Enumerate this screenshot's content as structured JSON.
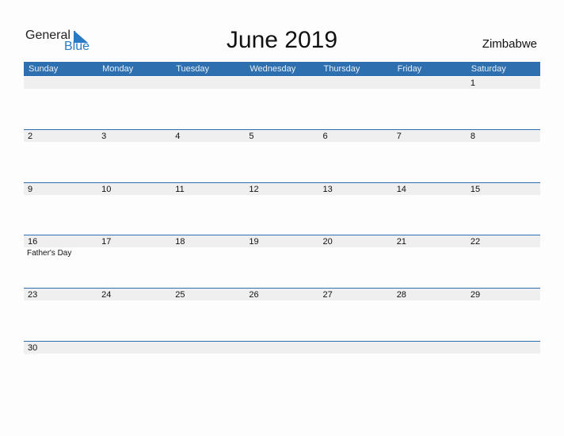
{
  "logo": {
    "line1": "General",
    "line2": "Blue"
  },
  "title": "June 2019",
  "country": "Zimbabwe",
  "colors": {
    "accent": "#2e6fb0",
    "strip": "#efefef"
  },
  "weekdays": [
    "Sunday",
    "Monday",
    "Tuesday",
    "Wednesday",
    "Thursday",
    "Friday",
    "Saturday"
  ],
  "weeks": [
    {
      "days": [
        "",
        "",
        "",
        "",
        "",
        "",
        "1"
      ],
      "events": [
        "",
        "",
        "",
        "",
        "",
        "",
        ""
      ]
    },
    {
      "days": [
        "2",
        "3",
        "4",
        "5",
        "6",
        "7",
        "8"
      ],
      "events": [
        "",
        "",
        "",
        "",
        "",
        "",
        ""
      ]
    },
    {
      "days": [
        "9",
        "10",
        "11",
        "12",
        "13",
        "14",
        "15"
      ],
      "events": [
        "",
        "",
        "",
        "",
        "",
        "",
        ""
      ]
    },
    {
      "days": [
        "16",
        "17",
        "18",
        "19",
        "20",
        "21",
        "22"
      ],
      "events": [
        "Father's Day",
        "",
        "",
        "",
        "",
        "",
        ""
      ]
    },
    {
      "days": [
        "23",
        "24",
        "25",
        "26",
        "27",
        "28",
        "29"
      ],
      "events": [
        "",
        "",
        "",
        "",
        "",
        "",
        ""
      ]
    },
    {
      "days": [
        "30",
        "",
        "",
        "",
        "",
        "",
        ""
      ],
      "events": [
        "",
        "",
        "",
        "",
        "",
        "",
        ""
      ]
    }
  ]
}
